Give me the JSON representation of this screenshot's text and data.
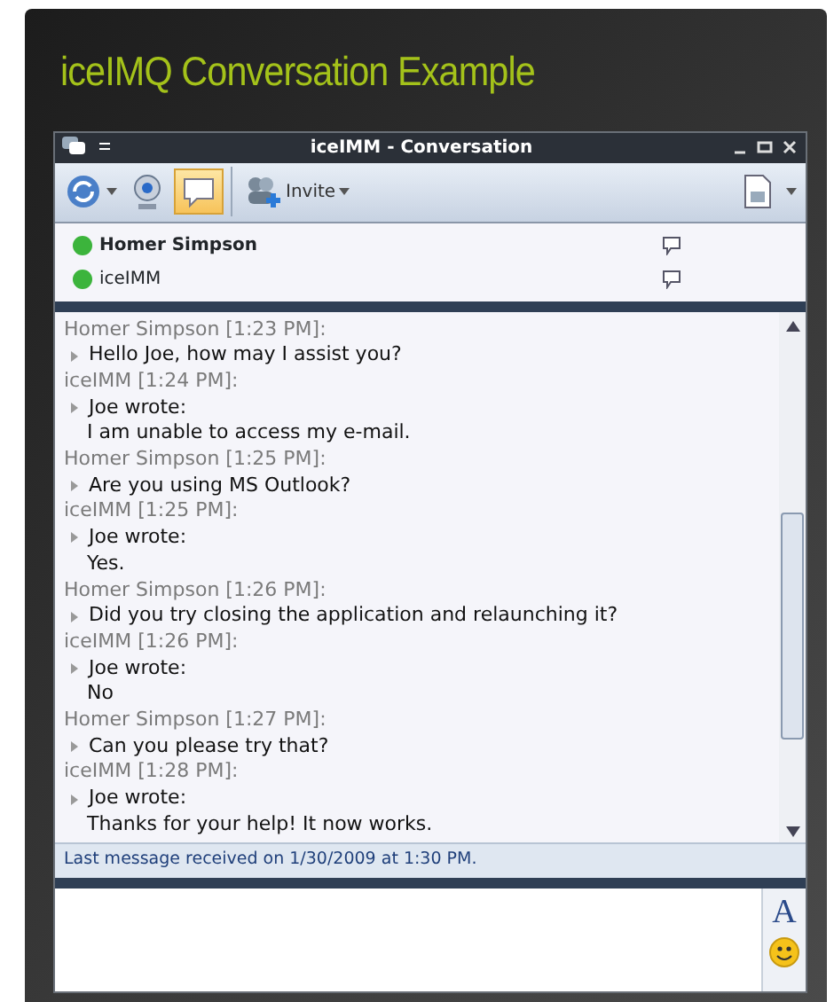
{
  "heading": "iceIMQ Conversation Example",
  "window": {
    "title": "iceIMM - Conversation"
  },
  "toolbar": {
    "chat_toggle_on": true,
    "invite_label": "Invite"
  },
  "participants": [
    {
      "name": "Homer Simpson",
      "bold": true,
      "color": "#3cb43c"
    },
    {
      "name": "iceIMM",
      "bold": false,
      "color": "#3cb43c"
    }
  ],
  "messages": [
    {
      "kind": "header",
      "text": "Homer Simpson [1:23 PM]:"
    },
    {
      "kind": "first",
      "text": "Hello Joe, how may I assist you?"
    },
    {
      "kind": "header",
      "text": "iceIMM [1:24 PM]:"
    },
    {
      "kind": "first",
      "text": "Joe wrote:"
    },
    {
      "kind": "more",
      "text": "I am unable to access my e-mail."
    },
    {
      "kind": "header",
      "text": "Homer Simpson [1:25 PM]:"
    },
    {
      "kind": "first",
      "text": "Are you using MS Outlook?"
    },
    {
      "kind": "header",
      "text": "iceIMM [1:25 PM]:"
    },
    {
      "kind": "first",
      "text": "Joe wrote:"
    },
    {
      "kind": "more",
      "text": "Yes."
    },
    {
      "kind": "header",
      "text": "Homer Simpson [1:26 PM]:"
    },
    {
      "kind": "first",
      "text": "Did you try closing the application and relaunching it?"
    },
    {
      "kind": "header",
      "text": "iceIMM [1:26 PM]:"
    },
    {
      "kind": "first",
      "text": "Joe wrote:"
    },
    {
      "kind": "more",
      "text": "No"
    },
    {
      "kind": "header",
      "text": "Homer Simpson [1:27 PM]:"
    },
    {
      "kind": "first",
      "text": "Can you please try that?"
    },
    {
      "kind": "header",
      "text": "iceIMM [1:28 PM]:"
    },
    {
      "kind": "first",
      "text": "Joe wrote:"
    },
    {
      "kind": "more",
      "text": "Thanks for your help! It now works."
    }
  ],
  "status_bar": "Last message received on 1/30/2009 at 1:30 PM.",
  "compose": {
    "font_button": "A"
  }
}
